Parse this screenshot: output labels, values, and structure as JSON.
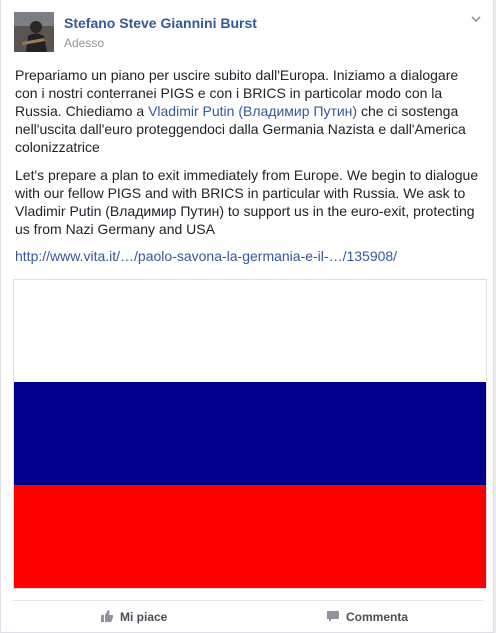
{
  "post": {
    "author": "Stefano Steve Giannini Burst",
    "timestamp": "Adesso",
    "italian": {
      "before_mention": "Prepariamo un piano per uscire subito dall'Europa. Iniziamo a dialogare con i nostri conterranei PIGS e con i BRICS in particolar modo con la Russia. Chiediamo a ",
      "mention": "Vladimir Putin (Владимир Путин)",
      "after_mention": " che ci sostenga nell'uscita dall'euro proteggendoci dalla Germania Nazista e dall'America colonizzatrice"
    },
    "english": "Let's prepare a plan to exit immediately from Europe. We begin to dialogue with our fellow PIGS and with BRICS in particular with Russia. We ask to Vladimir Putin (Владимир Путин) to support us in the euro-exit, protecting us from Nazi Germany and USA",
    "link": "http://www.vita.it/…/paolo-savona-la-germania-e-il-…/135908/",
    "flag_colors": {
      "top": "#ffffff",
      "middle": "#00008b",
      "bottom": "#ff0000"
    }
  },
  "actions": {
    "like_label": "Mi piace",
    "comment_label": "Commenta"
  },
  "icons": {
    "menu": "chevron-down-icon",
    "like": "thumbs-up-icon",
    "comment": "speech-bubble-icon"
  }
}
